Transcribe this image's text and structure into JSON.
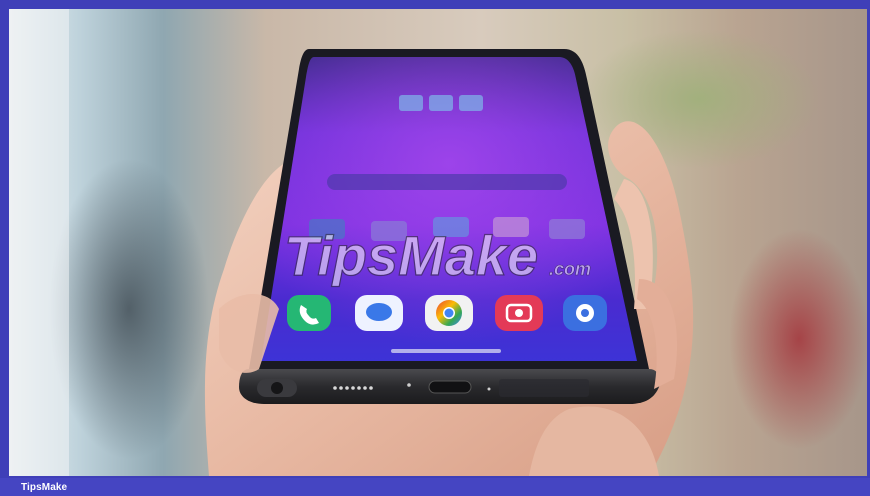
{
  "watermark": {
    "main": "TipsMake",
    "suffix": ".com"
  },
  "phone_apps": [
    "phone-app-icon",
    "messages-app-icon",
    "chrome-app-icon",
    "camera-app-icon",
    "settings-app-icon"
  ],
  "caption": {
    "text": "TipsMake"
  },
  "colors": {
    "border": "#3f3fb8",
    "caption_bar": "#4545c2",
    "screen": "#6a2fd8"
  }
}
